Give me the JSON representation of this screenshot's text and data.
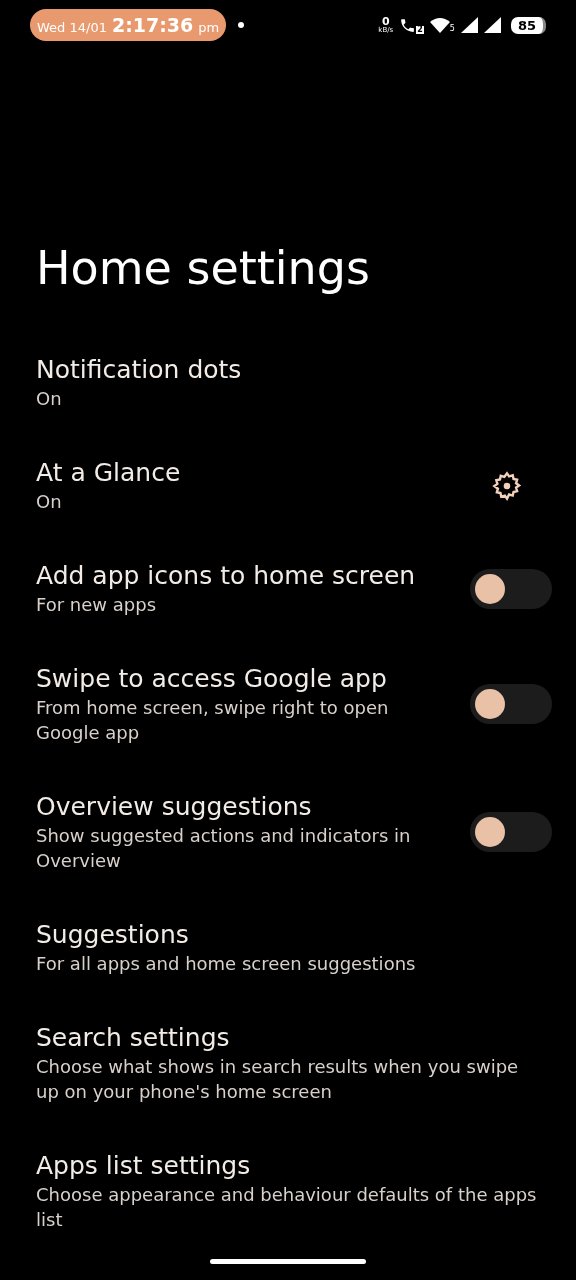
{
  "status_bar": {
    "date": "Wed 14/01",
    "time": "2:17:36",
    "ampm": "pm",
    "speed_value": "0",
    "speed_unit": "kB/s",
    "call_sim": "2",
    "wifi_band": "5",
    "battery": "85"
  },
  "title": "Home settings",
  "items": [
    {
      "kind": "plain",
      "title": "Notification dots",
      "subtitle": "On"
    },
    {
      "kind": "gear",
      "title": "At a Glance",
      "subtitle": "On"
    },
    {
      "kind": "toggle",
      "title": "Add app icons to home screen",
      "subtitle": "For new apps",
      "on": false
    },
    {
      "kind": "toggle",
      "title": "Swipe to access Google app",
      "subtitle": "From home screen, swipe right to open Google app",
      "on": false
    },
    {
      "kind": "toggle",
      "title": "Overview suggestions",
      "subtitle": "Show suggested actions and indicators in Overview",
      "on": false
    },
    {
      "kind": "plain",
      "title": "Suggestions",
      "subtitle": "For all apps and home screen suggestions"
    },
    {
      "kind": "plain",
      "title": "Search settings",
      "subtitle": "Choose what shows in search results when you swipe up on your phone's home screen"
    },
    {
      "kind": "plain",
      "title": "Apps list settings",
      "subtitle": "Choose appearance and behaviour defaults of the apps list"
    }
  ]
}
